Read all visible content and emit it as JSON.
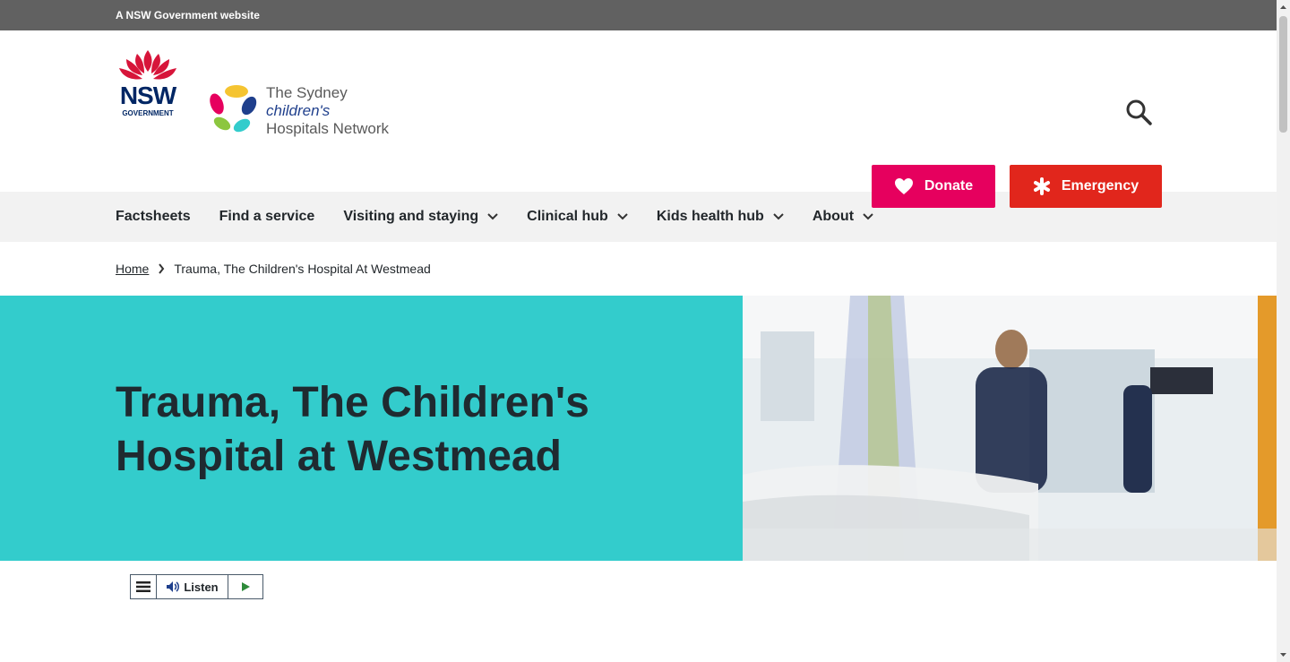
{
  "masthead": {
    "text": "A NSW Government website"
  },
  "logos": {
    "nsw_word": "NSW",
    "nsw_sub": "GOVERNMENT",
    "schn_line1": "The Sydney",
    "schn_line2": "children's",
    "schn_line3": "Hospitals Network"
  },
  "header": {
    "search_icon": "search-icon",
    "donate_label": "Donate",
    "emergency_label": "Emergency",
    "donate_color": "#e6005e",
    "emergency_color": "#e1261c"
  },
  "nav": {
    "items": [
      {
        "label": "Factsheets",
        "dropdown": false
      },
      {
        "label": "Find a service",
        "dropdown": false
      },
      {
        "label": "Visiting and staying",
        "dropdown": true
      },
      {
        "label": "Clinical hub",
        "dropdown": true
      },
      {
        "label": "Kids health hub",
        "dropdown": true
      },
      {
        "label": "About",
        "dropdown": true
      }
    ]
  },
  "breadcrumb": {
    "home": "Home",
    "current": "Trauma, The Children's Hospital At Westmead"
  },
  "hero": {
    "title": "Trauma, The Children's Hospital at Westmead",
    "bg_color": "#33cccc"
  },
  "listen": {
    "label": "Listen"
  }
}
